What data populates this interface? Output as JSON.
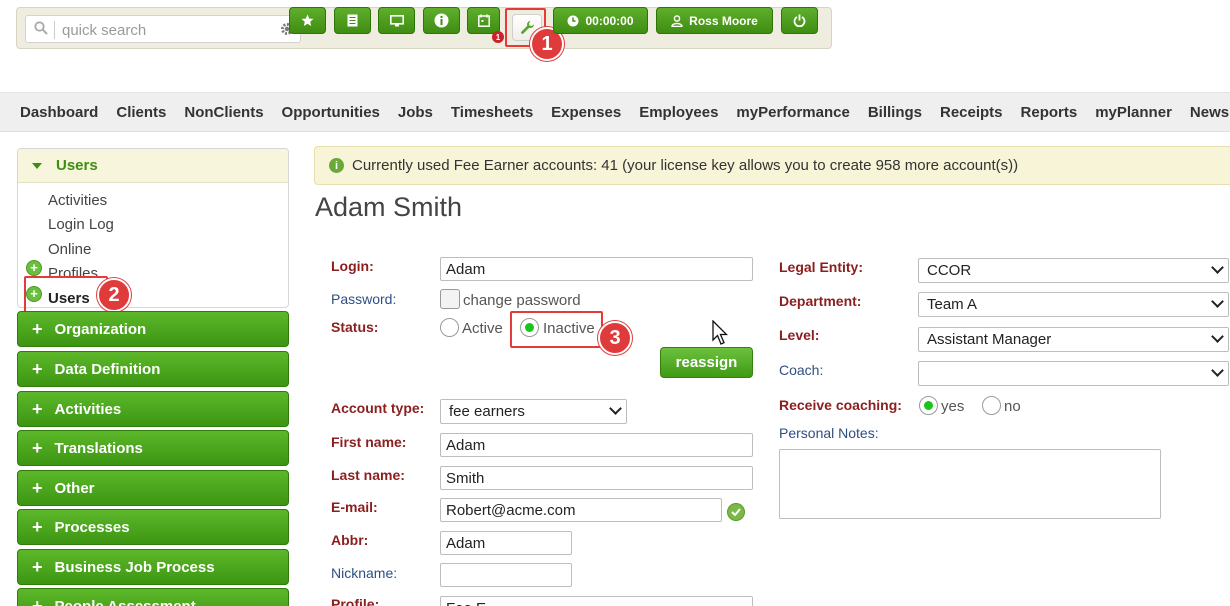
{
  "toolbar": {
    "search_placeholder": "quick search",
    "timer": "00:00:00",
    "user_name": "Ross Moore",
    "notification_count": "1"
  },
  "callouts": {
    "one": "1",
    "two": "2",
    "three": "3"
  },
  "nav": [
    "Dashboard",
    "Clients",
    "NonClients",
    "Opportunities",
    "Jobs",
    "Timesheets",
    "Expenses",
    "Employees",
    "myPerformance",
    "Billings",
    "Receipts",
    "Reports",
    "myPlanner",
    "Newsle"
  ],
  "sidebar": {
    "open_section": "Users",
    "items": [
      "Activities",
      "Login Log",
      "Online",
      "Profiles",
      "Users"
    ],
    "sections": [
      "Organization",
      "Data Definition",
      "Activities",
      "Translations",
      "Other",
      "Processes",
      "Business Job Process",
      "People Assessment"
    ]
  },
  "info": "Currently used Fee Earner accounts: 41 (your license key allows you to create 958 more account(s))",
  "page_title": "Adam Smith",
  "form": {
    "login_label": "Login:",
    "login": "Adam",
    "password_label": "Password:",
    "change_password": "change password",
    "status_label": "Status:",
    "active": "Active",
    "inactive": "Inactive",
    "reassign": "reassign",
    "account_type_label": "Account type:",
    "account_type": "fee earners",
    "first_name_label": "First name:",
    "first_name": "Adam",
    "last_name_label": "Last name:",
    "last_name": "Smith",
    "email_label": "E-mail:",
    "email": "Robert@acme.com",
    "abbr_label": "Abbr:",
    "abbr": "Adam",
    "nickname_label": "Nickname:",
    "nickname": "",
    "profile_label": "Profile:",
    "profile": "Fee E...",
    "legal_entity_label": "Legal Entity:",
    "legal_entity": "CCOR",
    "department_label": "Department:",
    "department": "Team A",
    "level_label": "Level:",
    "level": "Assistant Manager",
    "coach_label": "Coach:",
    "coach": "",
    "receive_coaching_label": "Receive coaching:",
    "yes": "yes",
    "no": "no",
    "personal_notes_label": "Personal Notes:"
  },
  "colors": {
    "accent_green": "#3f8d12",
    "callout_red": "#e03b3b",
    "required_label": "#8b1f1f",
    "optional_label": "#2e4f82"
  }
}
